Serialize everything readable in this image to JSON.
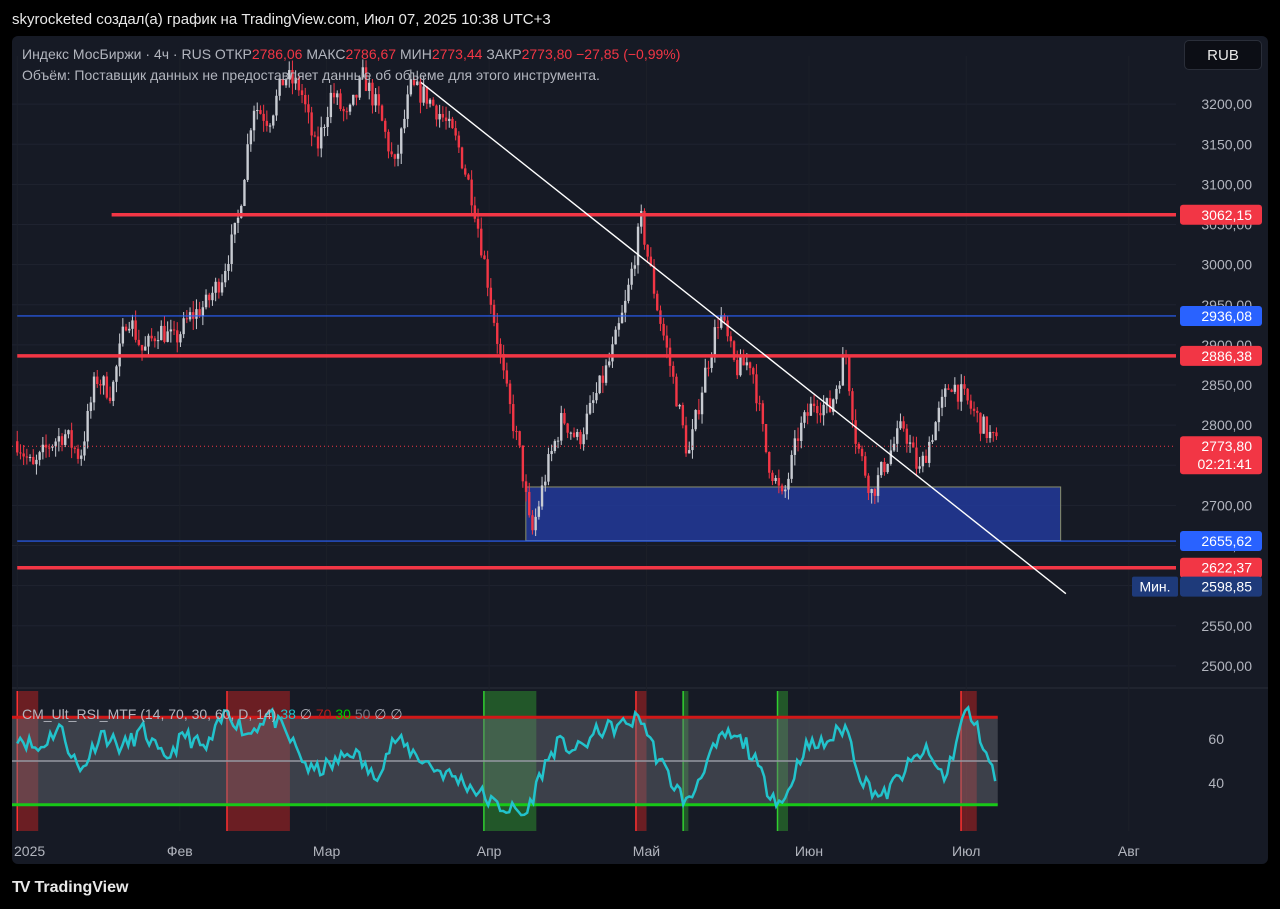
{
  "header": {
    "title": "skyrocketed создал(а) график на TradingView.com, Июл 07, 2025 10:38 UTC+3"
  },
  "currency_button": "RUB",
  "legend": {
    "symbol": "Индекс МосБиржи · 4ч · RUS",
    "o_label": "ОТКР",
    "o_value": "2786,06",
    "h_label": "МАКС",
    "h_value": "2786,67",
    "l_label": "МИН",
    "l_value": "2773,44",
    "c_label": "ЗАКР",
    "c_value": "2773,80",
    "change": "−27,85 (−0,99%)",
    "volume_note": "Объём: Поставщик данных не предоставляет данные об объеме для этого инструмента."
  },
  "rsi_legend": {
    "name": "CM_Ult_RSI_MTF (14, 70, 30, 60, D, 14)",
    "v1": "38",
    "v2": "∅",
    "v3": "70",
    "v4": "30",
    "v5": "50",
    "v6": "∅",
    "v7": "∅"
  },
  "footer": {
    "brand": "TradingView"
  },
  "colors": {
    "bg": "#161a25",
    "up": "#c8cbd2",
    "down": "#f23645",
    "resistance": "#f23645",
    "blue_line": "#2962ff",
    "rsi": "#22c3cc",
    "zone": "#22399a"
  },
  "chart_data": {
    "type": "candlestick",
    "symbol": "Индекс МосБиржи",
    "timeframe": "4ч",
    "x_labels": [
      "2025",
      "Фев",
      "Мар",
      "Апр",
      "Май",
      "Июн",
      "Июл",
      "Авг"
    ],
    "y_ticks": [
      "3200,00",
      "3150,00",
      "3100,00",
      "3050,00",
      "3000,00",
      "2950,00",
      "2900,00",
      "2850,00",
      "2800,00",
      "2750,00",
      "2700,00",
      "2650,00",
      "2600,00",
      "2550,00",
      "2500,00"
    ],
    "ylim": [
      2475,
      3260
    ],
    "price_labels": [
      {
        "value": 3062.15,
        "text": "3062,15",
        "color": "#f23645"
      },
      {
        "value": 2936.08,
        "text": "2936,08",
        "color": "#2962ff"
      },
      {
        "value": 2886.38,
        "text": "2886,38",
        "color": "#f23645"
      },
      {
        "value": 2773.8,
        "text": "2773,80",
        "color": "#f23645"
      },
      {
        "value": 2655.62,
        "text": "2655,62",
        "color": "#2962ff"
      },
      {
        "value": 2622.37,
        "text": "2622,37",
        "color": "#f23645"
      },
      {
        "value": 2598.85,
        "text": "2598,85",
        "color": "#1e3a7a"
      }
    ],
    "countdown": "02:21:41",
    "min_label": "Мин.",
    "horizontal_lines": [
      {
        "value": 3062.15,
        "from_date": "2025-01-19",
        "color": "#f23645"
      },
      {
        "value": 2936.08,
        "from_date": "2025-01-01",
        "color": "#2962ff"
      },
      {
        "value": 2886.38,
        "from_date": "2025-01-01",
        "color": "#f23645"
      },
      {
        "value": 2655.62,
        "from_date": "2025-01-01",
        "color": "#2962ff"
      },
      {
        "value": 2622.37,
        "from_date": "2025-01-01",
        "color": "#f23645"
      }
    ],
    "trendline": {
      "from": [
        "2025-03-19",
        3227
      ],
      "to": [
        "2025-07-20",
        2590
      ]
    },
    "zone": {
      "from_date": "2025-04-08",
      "to_date": "2025-07-19",
      "top": 2723,
      "bottom": 2656
    },
    "candles_path": [
      [
        "2025-01-01",
        2780
      ],
      [
        "2025-01-04",
        2745
      ],
      [
        "2025-01-07",
        2775
      ],
      [
        "2025-01-10",
        2790
      ],
      [
        "2025-01-13",
        2760
      ],
      [
        "2025-01-16",
        2860
      ],
      [
        "2025-01-19",
        2840
      ],
      [
        "2025-01-22",
        2940
      ],
      [
        "2025-01-25",
        2890
      ],
      [
        "2025-01-28",
        2920
      ],
      [
        "2025-01-31",
        2905
      ],
      [
        "2025-02-03",
        2935
      ],
      [
        "2025-02-06",
        2950
      ],
      [
        "2025-02-09",
        2985
      ],
      [
        "2025-02-12",
        3050
      ],
      [
        "2025-02-15",
        3200
      ],
      [
        "2025-02-18",
        3180
      ],
      [
        "2025-02-21",
        3235
      ],
      [
        "2025-02-24",
        3220
      ],
      [
        "2025-02-27",
        3140
      ],
      [
        "2025-03-02",
        3215
      ],
      [
        "2025-03-05",
        3180
      ],
      [
        "2025-03-08",
        3235
      ],
      [
        "2025-03-11",
        3190
      ],
      [
        "2025-03-14",
        3120
      ],
      [
        "2025-03-17",
        3220
      ],
      [
        "2025-03-20",
        3210
      ],
      [
        "2025-03-23",
        3185
      ],
      [
        "2025-03-26",
        3150
      ],
      [
        "2025-03-29",
        3080
      ],
      [
        "2025-04-01",
        2970
      ],
      [
        "2025-04-04",
        2850
      ],
      [
        "2025-04-07",
        2760
      ],
      [
        "2025-04-09",
        2660
      ],
      [
        "2025-04-12",
        2745
      ],
      [
        "2025-04-15",
        2810
      ],
      [
        "2025-04-18",
        2780
      ],
      [
        "2025-04-21",
        2830
      ],
      [
        "2025-04-24",
        2880
      ],
      [
        "2025-04-27",
        2950
      ],
      [
        "2025-04-30",
        3055
      ],
      [
        "2025-05-03",
        2950
      ],
      [
        "2025-05-06",
        2860
      ],
      [
        "2025-05-09",
        2760
      ],
      [
        "2025-05-12",
        2860
      ],
      [
        "2025-05-15",
        2940
      ],
      [
        "2025-05-18",
        2870
      ],
      [
        "2025-05-21",
        2880
      ],
      [
        "2025-05-24",
        2760
      ],
      [
        "2025-05-27",
        2705
      ],
      [
        "2025-05-30",
        2790
      ],
      [
        "2025-06-02",
        2830
      ],
      [
        "2025-06-05",
        2820
      ],
      [
        "2025-06-08",
        2890
      ],
      [
        "2025-06-10",
        2780
      ],
      [
        "2025-06-13",
        2715
      ],
      [
        "2025-06-16",
        2760
      ],
      [
        "2025-06-19",
        2800
      ],
      [
        "2025-06-22",
        2740
      ],
      [
        "2025-06-25",
        2800
      ],
      [
        "2025-06-28",
        2855
      ],
      [
        "2025-07-01",
        2830
      ],
      [
        "2025-07-04",
        2800
      ],
      [
        "2025-07-07",
        2773.8
      ]
    ],
    "rsi": {
      "ticks": [
        60,
        40
      ],
      "upper": 70,
      "lower": 30,
      "mid": 50,
      "last": 38,
      "path": [
        [
          "2025-01-01",
          62
        ],
        [
          "2025-01-05",
          55
        ],
        [
          "2025-01-09",
          66
        ],
        [
          "2025-01-13",
          45
        ],
        [
          "2025-01-17",
          63
        ],
        [
          "2025-01-21",
          56
        ],
        [
          "2025-01-25",
          64
        ],
        [
          "2025-01-29",
          50
        ],
        [
          "2025-02-02",
          62
        ],
        [
          "2025-02-06",
          55
        ],
        [
          "2025-02-10",
          73
        ],
        [
          "2025-02-14",
          62
        ],
        [
          "2025-02-18",
          72
        ],
        [
          "2025-02-22",
          60
        ],
        [
          "2025-02-26",
          45
        ],
        [
          "2025-03-02",
          48
        ],
        [
          "2025-03-06",
          55
        ],
        [
          "2025-03-10",
          42
        ],
        [
          "2025-03-14",
          60
        ],
        [
          "2025-03-18",
          53
        ],
        [
          "2025-03-22",
          46
        ],
        [
          "2025-03-26",
          42
        ],
        [
          "2025-03-30",
          36
        ],
        [
          "2025-04-02",
          30
        ],
        [
          "2025-04-05",
          28
        ],
        [
          "2025-04-08",
          25
        ],
        [
          "2025-04-11",
          45
        ],
        [
          "2025-04-14",
          58
        ],
        [
          "2025-04-18",
          55
        ],
        [
          "2025-04-22",
          64
        ],
        [
          "2025-04-26",
          66
        ],
        [
          "2025-04-30",
          70
        ],
        [
          "2025-05-03",
          52
        ],
        [
          "2025-05-06",
          40
        ],
        [
          "2025-05-09",
          30
        ],
        [
          "2025-05-12",
          48
        ],
        [
          "2025-05-16",
          62
        ],
        [
          "2025-05-20",
          58
        ],
        [
          "2025-05-24",
          38
        ],
        [
          "2025-05-27",
          30
        ],
        [
          "2025-05-31",
          56
        ],
        [
          "2025-06-04",
          58
        ],
        [
          "2025-06-08",
          66
        ],
        [
          "2025-06-11",
          42
        ],
        [
          "2025-06-15",
          33
        ],
        [
          "2025-06-19",
          45
        ],
        [
          "2025-06-23",
          55
        ],
        [
          "2025-06-27",
          42
        ],
        [
          "2025-07-01",
          74
        ],
        [
          "2025-07-04",
          60
        ],
        [
          "2025-07-07",
          38
        ]
      ],
      "bands": [
        {
          "from": "2025-01-01",
          "to": "2025-01-05",
          "color": "red"
        },
        {
          "from": "2025-02-10",
          "to": "2025-02-22",
          "color": "red"
        },
        {
          "from": "2025-03-31",
          "to": "2025-04-10",
          "color": "green"
        },
        {
          "from": "2025-04-29",
          "to": "2025-05-01",
          "color": "red"
        },
        {
          "from": "2025-05-08",
          "to": "2025-05-09",
          "color": "green"
        },
        {
          "from": "2025-05-26",
          "to": "2025-05-28",
          "color": "green"
        },
        {
          "from": "2025-06-30",
          "to": "2025-07-03",
          "color": "red"
        }
      ]
    }
  }
}
